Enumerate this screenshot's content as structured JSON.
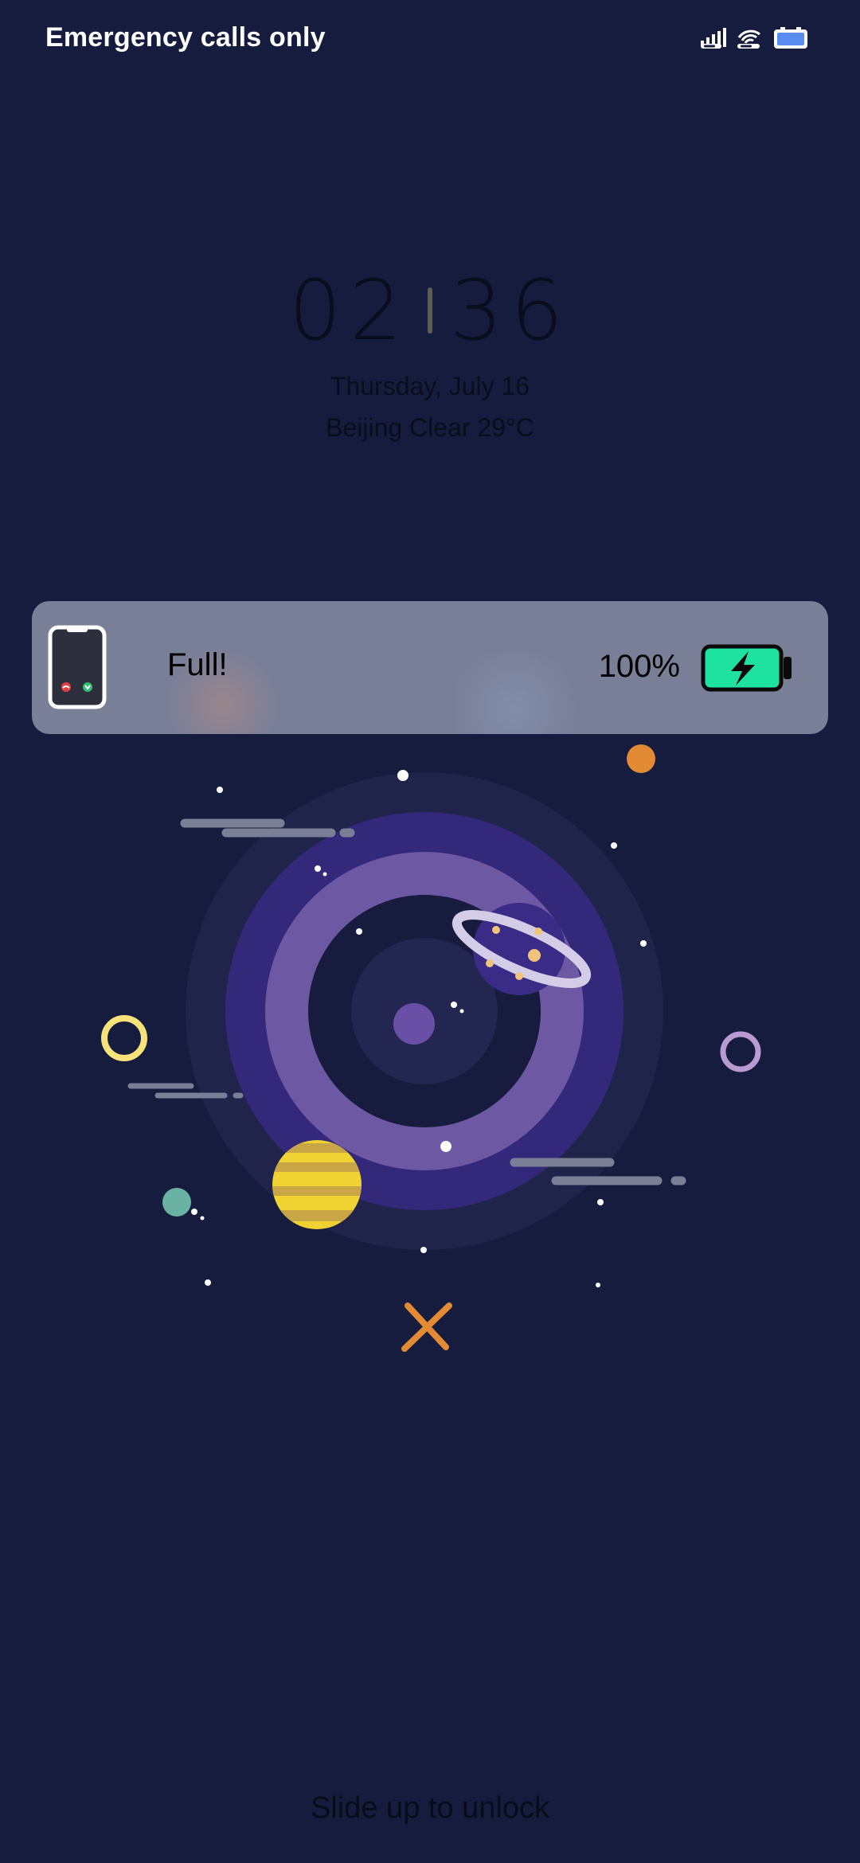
{
  "status_bar": {
    "carrier_text": "Emergency calls only",
    "icons": [
      "signal-icon",
      "wifi-icon",
      "battery-status-icon"
    ]
  },
  "clock": {
    "hours": "02",
    "minutes": "36",
    "date": "Thursday, July 16",
    "weather": "Beijing Clear 29°C"
  },
  "battery_card": {
    "status": "Full!",
    "percent": "100%",
    "charge_level": 1.0,
    "icons": [
      "phone-icon",
      "battery-charging-icon"
    ],
    "accent_color": "#1ee3a0"
  },
  "illustration": {
    "icons": [
      "planet-icon",
      "ringed-planet-icon",
      "striped-planet-icon",
      "star-icon",
      "cross-icon",
      "ring-icon"
    ]
  },
  "unlock_hint": "Slide up to unlock"
}
